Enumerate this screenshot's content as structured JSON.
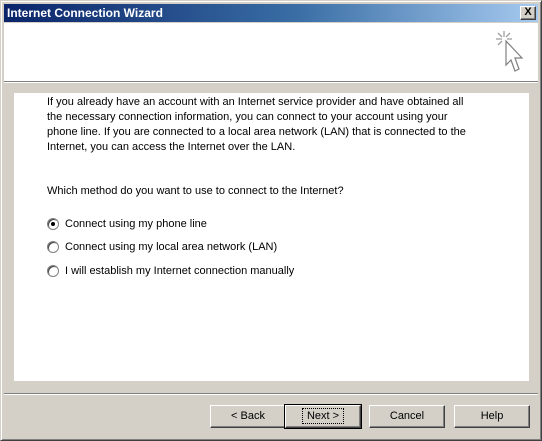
{
  "window": {
    "title": "Internet Connection Wizard",
    "close_glyph": "X"
  },
  "header": {
    "icon": "wizard-cursor-icon"
  },
  "main": {
    "intro_lines": [
      "If you already have an account with an Internet service provider and have obtained all",
      "the necessary connection information, you can connect to your account using your",
      "phone line. If you are connected to a local area network (LAN) that is connected to the",
      "Internet, you can access the Internet over the LAN."
    ],
    "question": "Which method do you want to use to connect to the Internet?",
    "options": [
      {
        "label": "Connect using my phone line",
        "checked": true
      },
      {
        "label": "Connect using my local area network (LAN)",
        "checked": false
      },
      {
        "label": "I will establish my Internet connection manually",
        "checked": false
      }
    ]
  },
  "buttons": {
    "back": "< Back",
    "next": "Next >",
    "cancel": "Cancel",
    "help": "Help"
  }
}
